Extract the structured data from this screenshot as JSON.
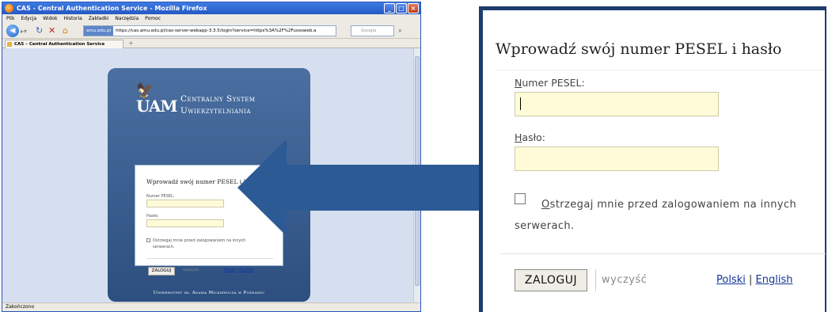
{
  "browser": {
    "window_title": "CAS - Central Authentication Service - Mozilla Firefox",
    "menu": [
      "Plik",
      "Edycja",
      "Widok",
      "Historia",
      "Zakładki",
      "Narzędzia",
      "Pomoc"
    ],
    "url_site": "amu.edu.pl",
    "url": "https://cas.amu.edu.pl/cas-server-webapp-3.3.5/login?service=https%3A%2F%2Fusosweb.a",
    "search_placeholder": "Google",
    "tab_title": "CAS – Central Authentication Service",
    "status": "Zakończono"
  },
  "cas_page": {
    "logo_text": "UAM",
    "system_line1": "Centralny System",
    "system_line2": "Uwierzytelniania",
    "heading": "Wprowadź swój numer PESEL i hasło",
    "pesel_label": "Numer PESEL:",
    "password_label": "Hasło:",
    "warn_text": "Ostrzegaj mnie przed zalogowaniem na innych serwerach.",
    "login_button": "ZALOGUJ",
    "clear_label": "wyczyść",
    "lang_polski": "Polski",
    "lang_english": "English",
    "footer": "Uniwersytet im. Adama Mickiewicza w Poznaniu"
  },
  "zoom": {
    "heading": "Wprowadź swój numer PESEL i hasło",
    "pesel_first": "N",
    "pesel_rest": "umer PESEL:",
    "password_first": "H",
    "password_rest": "asło:",
    "warn_first": "O",
    "warn_rest": "strzegaj mnie przed zalogowaniem na innych serwerach.",
    "login_button": "ZALOGUJ",
    "clear_label": "wyczyść",
    "lang_polski": "Polski",
    "lang_sep": "|",
    "lang_english": "English"
  },
  "colors": {
    "arrow": "#2c5a95",
    "cas_card": "#3b5f91",
    "input_bg": "#fffbd8",
    "link": "#12359a"
  }
}
